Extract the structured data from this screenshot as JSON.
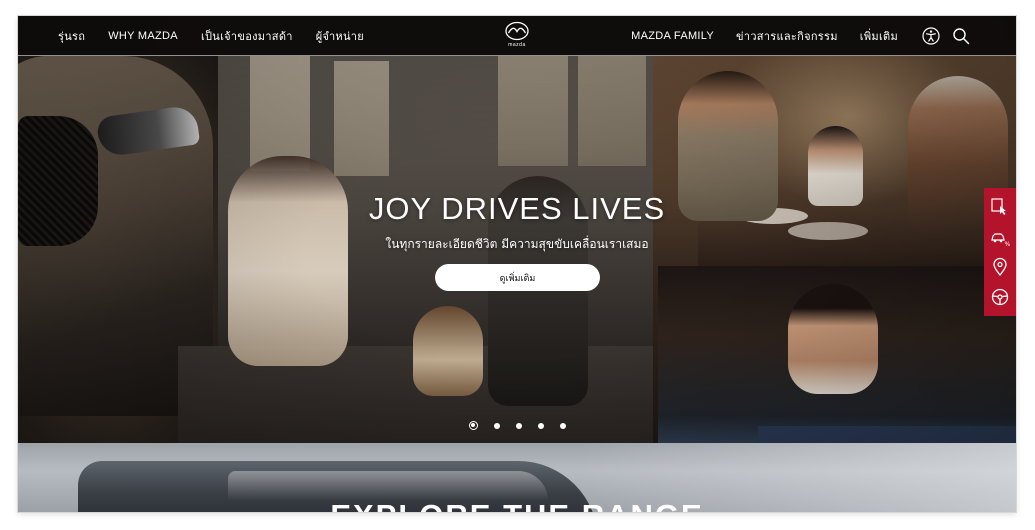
{
  "header": {
    "nav_left": [
      "รุ่นรถ",
      "WHY MAZDA",
      "เป็นเจ้าของมาสด้า",
      "ผู้จำหน่าย"
    ],
    "logo_text": "mazda",
    "nav_right": [
      "MAZDA FAMILY",
      "ข่าวสารและกิจกรรม",
      "เพิ่มเติม"
    ],
    "icons": [
      "accessibility-icon",
      "search-icon"
    ]
  },
  "hero": {
    "title": "JOY DRIVES LIVES",
    "subtitle": "ในทุกรายละเอียดชีวิต มีความสุขขับเคลื่อนเราเสมอ",
    "button_label": "ดูเพิ่มเติม",
    "slides_total": 5,
    "active_slide": 1
  },
  "side_panel": {
    "icons": [
      "test-drive-icon",
      "price-car-icon",
      "location-pin-icon",
      "steering-wheel-icon"
    ],
    "color": "#b3142c"
  },
  "explore": {
    "title": "EXPLORE THE RANGE"
  },
  "colors": {
    "header_bg": "#0e0c0b",
    "accent": "#b3142c",
    "text": "#ffffff"
  }
}
